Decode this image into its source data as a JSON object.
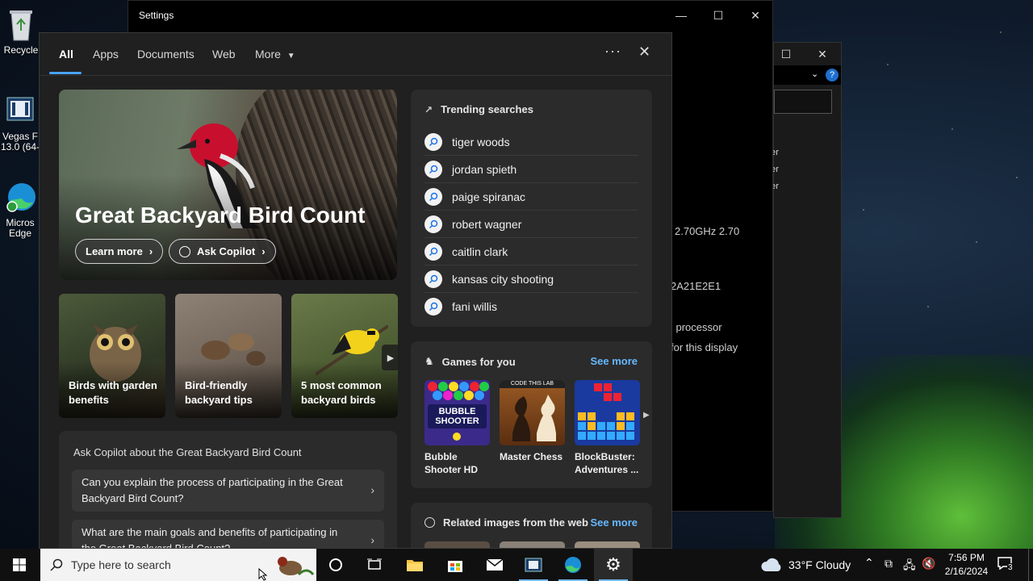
{
  "desktop": {
    "icons": [
      {
        "label": "Recycle",
        "icon": "recycle-bin-icon"
      },
      {
        "label": "Vegas F 13.0 (64-",
        "icon": "vegas-icon"
      },
      {
        "label": "Micros Edge",
        "icon": "edge-icon"
      }
    ]
  },
  "settings_window": {
    "title": "Settings",
    "lines": [
      "2.70GHz   2.70",
      "2A21E2E1",
      "l processor",
      "for this display"
    ]
  },
  "explorer_window": {
    "lines": [
      "der",
      "der",
      "der"
    ]
  },
  "search_panel": {
    "tabs": [
      {
        "label": "All",
        "active": true
      },
      {
        "label": "Apps"
      },
      {
        "label": "Documents"
      },
      {
        "label": "Web"
      },
      {
        "label": "More"
      }
    ],
    "more_options_icon": "ellipsis-icon",
    "close_icon": "close-icon",
    "hero": {
      "title": "Great Backyard Bird Count",
      "learn_more": "Learn more",
      "ask_copilot": "Ask Copilot"
    },
    "cards": [
      {
        "label": "Birds with garden benefits"
      },
      {
        "label": "Bird-friendly backyard tips"
      },
      {
        "label": "5 most common backyard birds"
      }
    ],
    "copilot": {
      "heading": "Ask Copilot about the Great Backyard Bird Count",
      "questions": [
        "Can you explain the process of participating in the Great Backyard Bird Count?",
        "What are the main goals and benefits of participating in the Great Backyard Bird Count?"
      ]
    },
    "trending": {
      "heading": "Trending searches",
      "items": [
        "tiger woods",
        "jordan spieth",
        "paige spiranac",
        "robert wagner",
        "caitlin clark",
        "kansas city shooting",
        "fani willis"
      ]
    },
    "games": {
      "heading": "Games for you",
      "see_more": "See more",
      "items": [
        {
          "label": "Bubble Shooter HD",
          "thumb_text": "BUBBLE SHOOTER"
        },
        {
          "label": "Master Chess",
          "thumb_text": "CODE THIS LAB"
        },
        {
          "label": "BlockBuster: Adventures ..."
        }
      ]
    },
    "related": {
      "heading": "Related images from the web",
      "see_more": "See more"
    }
  },
  "taskbar": {
    "search_placeholder": "Type here to search",
    "weather": "33°F  Cloudy",
    "time": "7:56 PM",
    "date": "2/16/2024",
    "notifications": "3"
  }
}
